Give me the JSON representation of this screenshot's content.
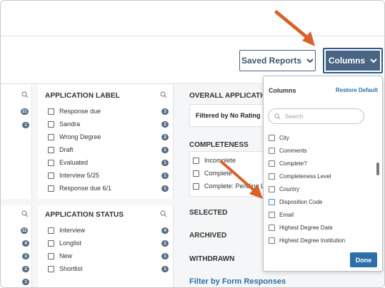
{
  "toolbar": {
    "saved_reports_label": "Saved Reports",
    "columns_label": "Columns"
  },
  "left_partial_panel_top": {
    "badges": [
      "21",
      "1"
    ]
  },
  "left_partial_panel_bottom": {
    "badges": [
      "11",
      "4",
      "3",
      "3",
      "1"
    ]
  },
  "application_label": {
    "title": "APPLICATION LABEL",
    "items": [
      {
        "label": "Response due",
        "count": "3"
      },
      {
        "label": "Sandra",
        "count": "2"
      },
      {
        "label": "Wrong Degree",
        "count": "2"
      },
      {
        "label": "Draft",
        "count": "1"
      },
      {
        "label": "Evaluated",
        "count": "1"
      },
      {
        "label": "Interview 5/25",
        "count": "1"
      },
      {
        "label": "Response due 6/1",
        "count": "1"
      }
    ]
  },
  "application_status": {
    "title": "APPLICATION STATUS",
    "items": [
      {
        "label": "Interview",
        "count": "4"
      },
      {
        "label": "Longlist",
        "count": "1"
      },
      {
        "label": "New",
        "count": "1"
      },
      {
        "label": "Shortlist",
        "count": "1"
      }
    ]
  },
  "overall": {
    "title": "OVERALL APPLICATION",
    "filter_text": "Filtered by No Rating"
  },
  "completeness": {
    "title": "COMPLETENESS",
    "items": [
      "Incomplete",
      "Complete",
      "Complete: Pending Let"
    ]
  },
  "sections": {
    "selected": "SELECTED",
    "archived": "ARCHIVED",
    "withdrawn": "WITHDRAWN",
    "filter_form": "Filter by Form Responses"
  },
  "columns_dropdown": {
    "title": "Columns",
    "restore": "Restore Default",
    "search_placeholder": "Search",
    "items": [
      "City",
      "Comments",
      "Complete?",
      "Completeness Level",
      "Country",
      "Disposition Code",
      "Email",
      "Highest Degree Date",
      "Highest Degree Institution"
    ],
    "done_label": "Done"
  },
  "colors": {
    "accent": "#2d6fa8",
    "button_dark": "#4a6583",
    "arrow": "#d9622b",
    "badge": "#556d86"
  }
}
